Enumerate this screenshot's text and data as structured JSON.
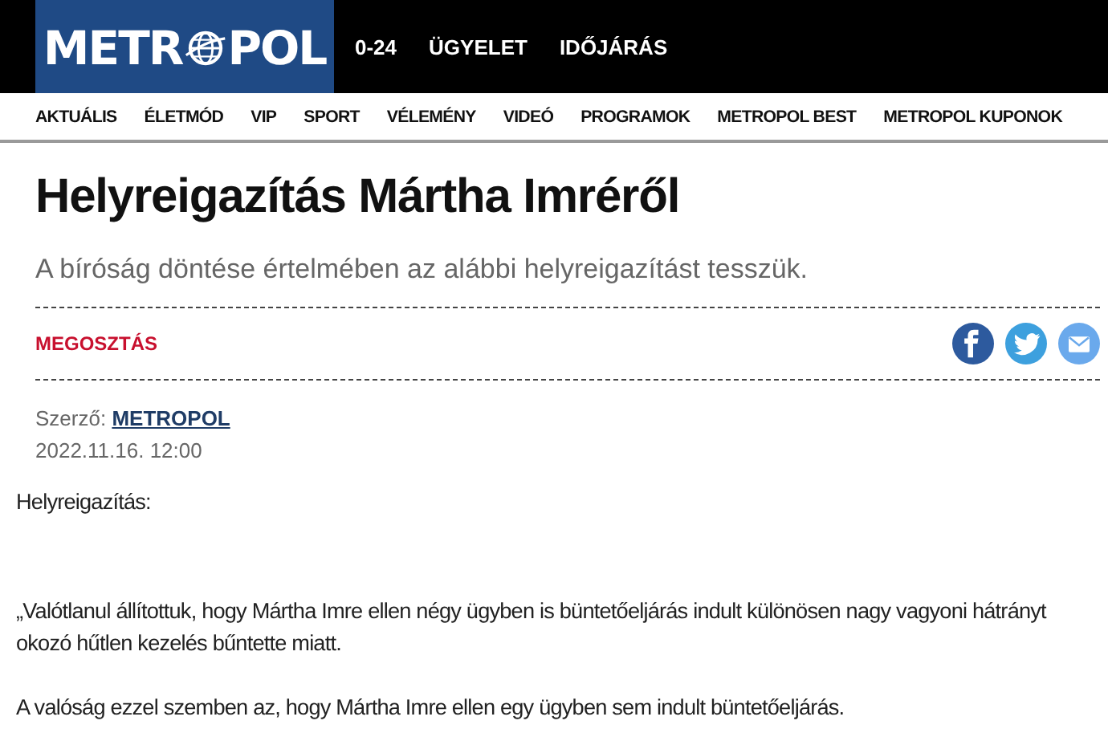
{
  "header": {
    "logo": {
      "left": "METR",
      "right": "POL"
    },
    "top_links": [
      "0-24",
      "ÜGYELET",
      "IDŐJÁRÁS"
    ]
  },
  "nav": {
    "items": [
      "AKTUÁLIS",
      "ÉLETMÓD",
      "VIP",
      "SPORT",
      "VÉLEMÉNY",
      "VIDEÓ",
      "PROGRAMOK",
      "METROPOL BEST",
      "METROPOL KUPONOK"
    ]
  },
  "article": {
    "title": "Helyreigazítás Mártha Imréről",
    "lead": "A bíróság döntése értelmében az alábbi helyreigazítást tesszük.",
    "share": {
      "label": "MEGOSZTÁS",
      "buttons": [
        {
          "kind": "facebook",
          "color": "#2d5a9e"
        },
        {
          "kind": "twitter",
          "color": "#3da0de"
        },
        {
          "kind": "email",
          "color": "#6aa9ec"
        }
      ]
    },
    "author_label": "Szerző:",
    "author": "METROPOL",
    "date": "2022.11.16. 12:00",
    "body": [
      "Helyreigazítás:",
      "„Valótlanul állítottuk, hogy Mártha Imre ellen négy ügyben is büntetőeljárás indult különösen nagy vagyoni hátrányt okozó hűtlen kezelés bűntette miatt.",
      "A valóság ezzel szemben az, hogy Mártha Imre ellen egy ügyben sem indult büntetőeljárás."
    ]
  }
}
